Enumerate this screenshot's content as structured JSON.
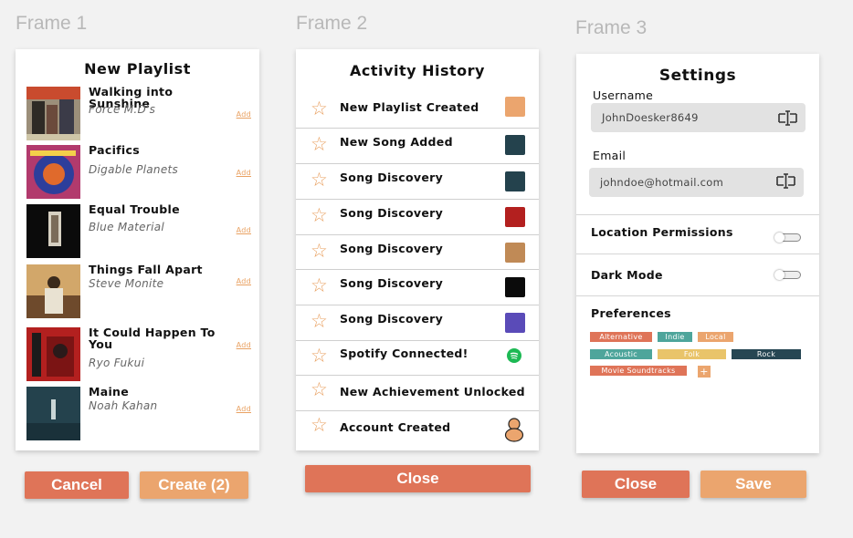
{
  "frames": [
    "Frame 1",
    "Frame 2",
    "Frame 3"
  ],
  "playlist": {
    "title": "New Playlist",
    "add_label": "Add",
    "items": [
      {
        "title": "Walking into Sunshine",
        "artist": "Force M.D's"
      },
      {
        "title": "Pacifics",
        "artist": "Digable Planets"
      },
      {
        "title": "Equal Trouble",
        "artist": "Blue Material"
      },
      {
        "title": "Things Fall Apart",
        "artist": "Steve Monite"
      },
      {
        "title": "It Could Happen To You",
        "artist": "Ryo Fukui"
      },
      {
        "title": "Maine",
        "artist": "Noah Kahan"
      }
    ],
    "cancel_label": "Cancel",
    "create_label": "Create (2)"
  },
  "activity": {
    "title": "Activity History",
    "items": [
      {
        "label": "New Playlist Created"
      },
      {
        "label": "New Song Added"
      },
      {
        "label": "Song Discovery"
      },
      {
        "label": "Song Discovery"
      },
      {
        "label": "Song Discovery"
      },
      {
        "label": "Song Discovery"
      },
      {
        "label": "Song Discovery"
      },
      {
        "label": "Spotify Connected!"
      },
      {
        "label": "New Achievement Unlocked"
      },
      {
        "label": "Account Created"
      }
    ],
    "close_label": "Close"
  },
  "settings": {
    "title": "Settings",
    "username_label": "Username",
    "username_value": "JohnDoesker8649",
    "email_label": "Email",
    "email_value": "johndoe@hotmail.com",
    "location_label": "Location Permissions",
    "dark_mode_label": "Dark Mode",
    "preferences_label": "Preferences",
    "tags": [
      {
        "label": "Alternative",
        "color": "#df7458"
      },
      {
        "label": "Indie",
        "color": "#4ea59b"
      },
      {
        "label": "Local",
        "color": "#eba56e"
      },
      {
        "label": "Acoustic",
        "color": "#4ea59b"
      },
      {
        "label": "Folk",
        "color": "#e9c46a"
      },
      {
        "label": "Rock",
        "color": "#264653"
      },
      {
        "label": "Movie Soundtracks",
        "color": "#df7458"
      }
    ],
    "add_tag": "+",
    "close_label": "Close",
    "save_label": "Save"
  }
}
